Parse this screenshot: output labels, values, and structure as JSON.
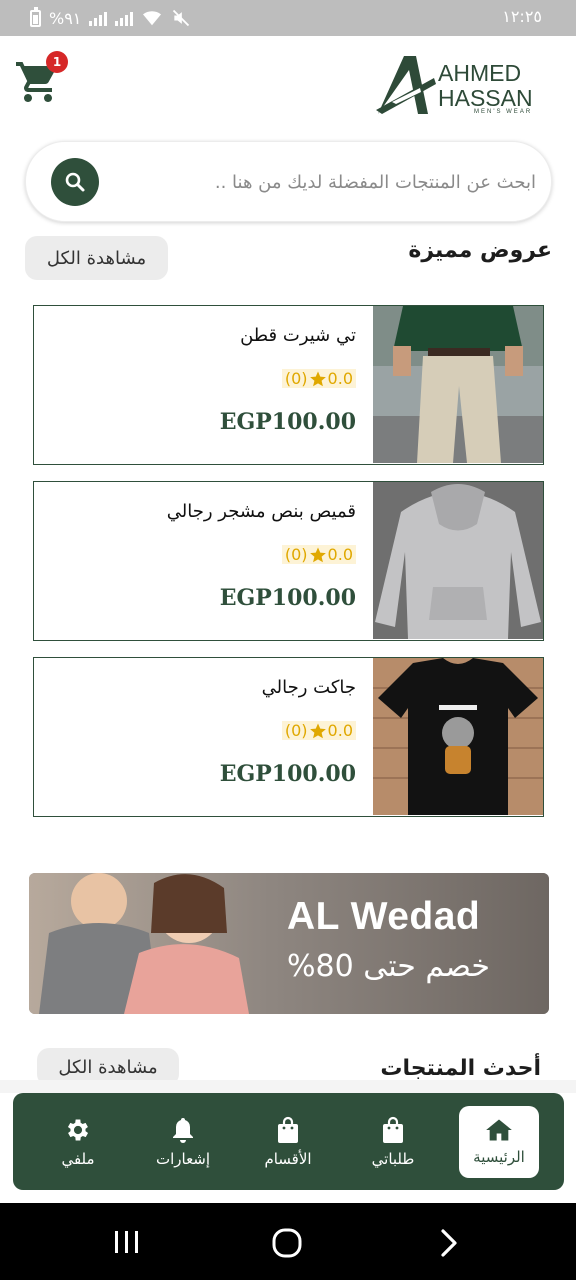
{
  "status_bar": {
    "battery_percent": "%٩١",
    "time": "١٢:٢٥"
  },
  "header": {
    "cart_badge": "1",
    "logo": {
      "line1": "AHMED",
      "line2": "HASSAN",
      "tagline": "MEN'S WEAR"
    }
  },
  "search": {
    "placeholder": "ابحث عن المنتجات المفضلة لديك من هنا .."
  },
  "featured": {
    "title": "عروض مميزة",
    "see_all": "مشاهدة الكل",
    "products": [
      {
        "name": "تي شيرت قطن",
        "rating": "0.0",
        "reviews": "(0)",
        "price": "EGP100.00"
      },
      {
        "name": "قميص بنص مشجر رجالي",
        "rating": "0.0",
        "reviews": "(0)",
        "price": "EGP100.00"
      },
      {
        "name": "جاكت رجالي",
        "rating": "0.0",
        "reviews": "(0)",
        "price": "EGP100.00"
      }
    ]
  },
  "banner": {
    "title": "AL Wedad",
    "subtitle": "خصم حتى 80%"
  },
  "latest": {
    "title": "أحدث المنتجات",
    "see_all": "مشاهدة الكل"
  },
  "bottom_nav": {
    "items": [
      {
        "label": "الرئيسية",
        "icon": "home-icon",
        "active": true
      },
      {
        "label": "طلباتي",
        "icon": "shopping-bag-icon"
      },
      {
        "label": "الأقسام",
        "icon": "shopping-bag-icon"
      },
      {
        "label": "إشعارات",
        "icon": "bell-icon"
      },
      {
        "label": "ملفي",
        "icon": "gear-icon"
      }
    ]
  },
  "colors": {
    "brand": "#2f4f3b",
    "badge": "#d62828",
    "star": "#e0a800"
  }
}
